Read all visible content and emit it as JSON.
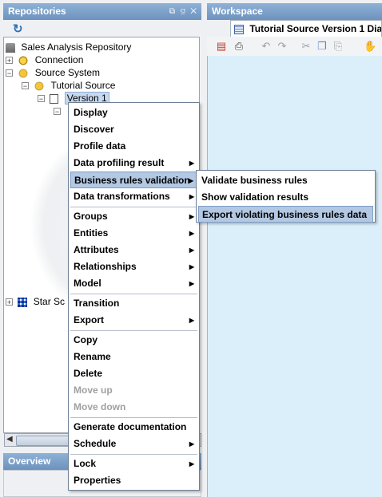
{
  "repositories_panel": {
    "title": "Repositories",
    "controls": "⧉ ⫑ ✕"
  },
  "tree": {
    "root": "Sales Analysis Repository",
    "connection": "Connection",
    "source_system": "Source System",
    "tutorial_source": "Tutorial Source",
    "version": "Version 1",
    "star_schema": "Star Sc"
  },
  "overview_panel": {
    "title": "Overview"
  },
  "workspace_panel": {
    "title": "Workspace",
    "tab_label": "Tutorial Source Version 1 Dia"
  },
  "context_menu": {
    "items": [
      "Display",
      "Discover",
      "Profile data",
      "Data profiling result",
      "Business rules validation",
      "Data transformations",
      "Groups",
      "Entities",
      "Attributes",
      "Relationships",
      "Model",
      "Transition",
      "Export",
      "Copy",
      "Rename",
      "Delete",
      "Move up",
      "Move down",
      "Generate documentation",
      "Schedule",
      "Lock",
      "Properties"
    ]
  },
  "submenu": {
    "items": [
      "Validate business rules",
      "Show validation results",
      "Export violating business rules data"
    ]
  },
  "colors": {
    "panel_header": "#7c9fc9",
    "highlight": "#b3c8e3",
    "canvas": "#dbeffa"
  }
}
